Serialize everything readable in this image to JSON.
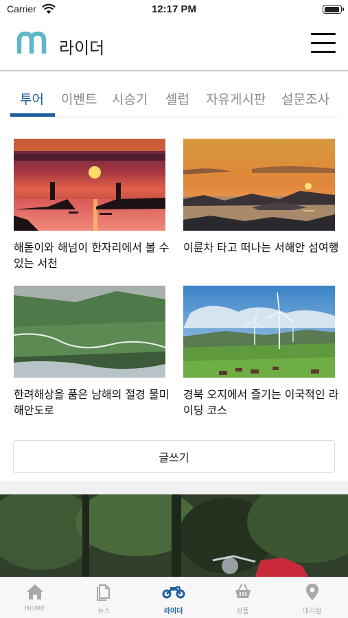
{
  "status_bar": {
    "carrier": "Carrier",
    "time": "12:17 PM"
  },
  "header": {
    "title": "라이더"
  },
  "tabs": [
    {
      "label": "투어",
      "active": true
    },
    {
      "label": "이벤트",
      "active": false
    },
    {
      "label": "시승기",
      "active": false
    },
    {
      "label": "셀럽",
      "active": false
    },
    {
      "label": "자유게시판",
      "active": false
    },
    {
      "label": "설문조사",
      "active": false
    }
  ],
  "posts": [
    {
      "title": "해돋이와 해넘이 한자리에서 볼 수 있는 서천"
    },
    {
      "title": "이륜차 타고 떠나는 서해안 섬여행"
    },
    {
      "title": "한려해상을 품은 남해의 절경 물미해안도로"
    },
    {
      "title": "경북 오지에서 즐기는 이국적인 라이딩 코스"
    }
  ],
  "write_button": {
    "label": "글쓰기"
  },
  "bottom_nav": [
    {
      "label": "HOME",
      "icon": "home-icon",
      "active": false
    },
    {
      "label": "뉴스",
      "icon": "news-icon",
      "active": false
    },
    {
      "label": "라이더",
      "icon": "motorcycle-icon",
      "active": true
    },
    {
      "label": "상품",
      "icon": "basket-icon",
      "active": false
    },
    {
      "label": "대리점",
      "icon": "location-pin-icon",
      "active": false
    }
  ],
  "colors": {
    "accent": "#1f5f9e",
    "logo": "#5fb8c9",
    "inactive": "#a8a8a8"
  }
}
